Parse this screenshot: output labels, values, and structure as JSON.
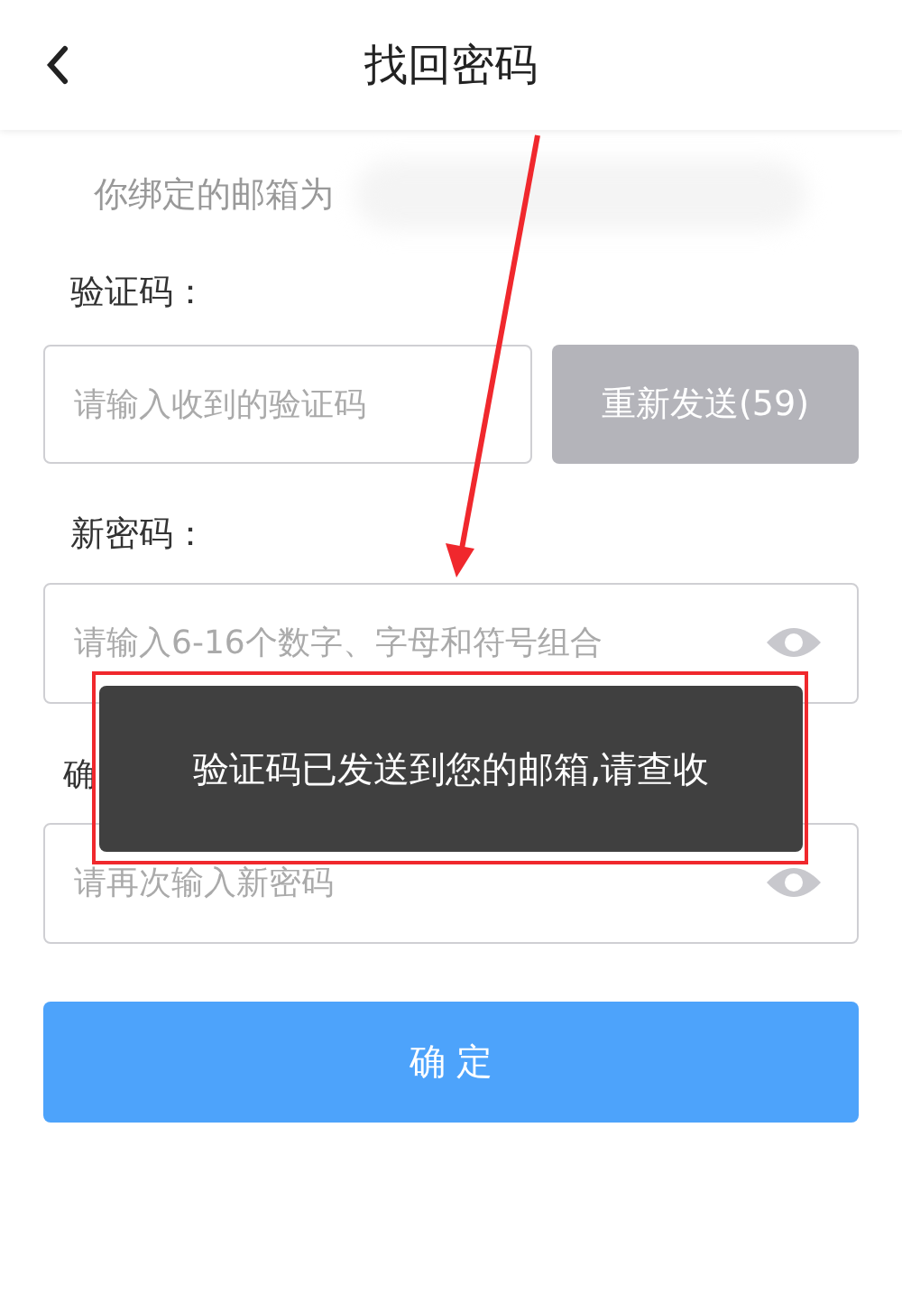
{
  "header": {
    "title": "找回密码"
  },
  "email_note": "你绑定的邮箱为",
  "code": {
    "label": "验证码：",
    "placeholder": "请输入收到的验证码",
    "resend": "重新发送(59)",
    "resend_disabled": true
  },
  "new_password": {
    "label": "新密码：",
    "placeholder": "请输入6-16个数字、字母和符号组合"
  },
  "confirm_password": {
    "label": "确",
    "placeholder": "请再次输入新密码"
  },
  "submit": "确 定",
  "toast": "验证码已发送到您的邮箱,请查收"
}
